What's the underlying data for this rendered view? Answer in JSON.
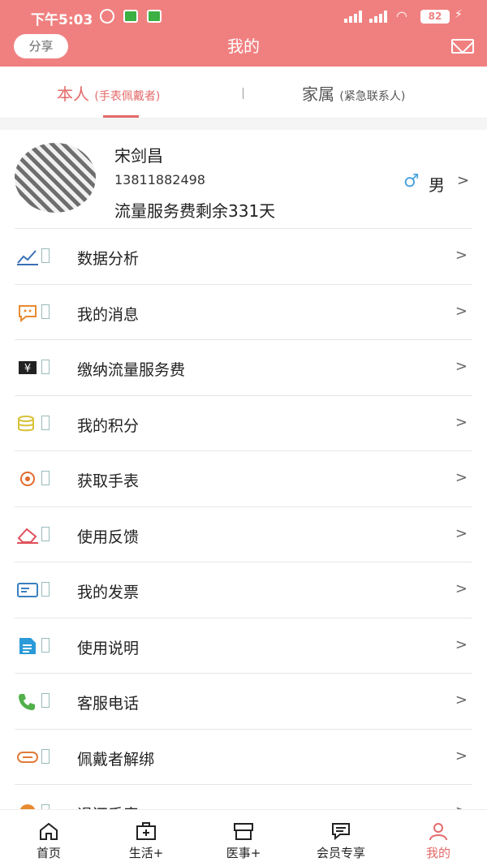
{
  "status": {
    "time": "下午5:03",
    "battery": "82",
    "signal1": "HD",
    "signal2": "HD"
  },
  "header": {
    "share_label": "分享",
    "title": "我的"
  },
  "tabs": [
    {
      "label": "本人",
      "sub": "(手表佩戴者)",
      "active": true
    },
    {
      "label": "家属",
      "sub": "(紧急联系人)",
      "active": false
    }
  ],
  "profile": {
    "name": "宋剑昌",
    "phone": "13811882498",
    "fee_status": "流量服务费剩余331天",
    "gender": "男",
    "gender_icon": "male-symbol-icon"
  },
  "menu": [
    {
      "label": "数据分析",
      "icon": "chart-icon",
      "color": "#3a6fb5"
    },
    {
      "label": "我的消息",
      "icon": "message-icon",
      "color": "#e88a2e"
    },
    {
      "label": "缴纳流量服务费",
      "icon": "payment-icon",
      "color": "#222222"
    },
    {
      "label": "我的积分",
      "icon": "coins-icon",
      "color": "#d8c23a"
    },
    {
      "label": "获取手表",
      "icon": "eye-target-icon",
      "color": "#e06b2e"
    },
    {
      "label": "使用反馈",
      "icon": "eraser-icon",
      "color": "#e0505a"
    },
    {
      "label": "我的发票",
      "icon": "invoice-icon",
      "color": "#3a7fc0"
    },
    {
      "label": "使用说明",
      "icon": "document-icon",
      "color": "#2a9ad8"
    },
    {
      "label": "客服电话",
      "icon": "phone-icon",
      "color": "#52b04a"
    },
    {
      "label": "佩戴者解绑",
      "icon": "unlink-icon",
      "color": "#e07a3a"
    },
    {
      "label": "退还手表",
      "icon": "return-icon",
      "color": "#e88a2e"
    }
  ],
  "nav": [
    {
      "label": "首页",
      "icon": "home-icon",
      "active": false
    },
    {
      "label": "生活+",
      "icon": "medical-kit-icon",
      "active": false
    },
    {
      "label": "医事+",
      "icon": "box-icon",
      "active": false
    },
    {
      "label": "会员专享",
      "icon": "chat-bubble-icon",
      "active": false
    },
    {
      "label": "我的",
      "icon": "user-icon",
      "active": true
    }
  ],
  "colors": {
    "brand": "#f08080",
    "accent": "#e46a6a"
  }
}
